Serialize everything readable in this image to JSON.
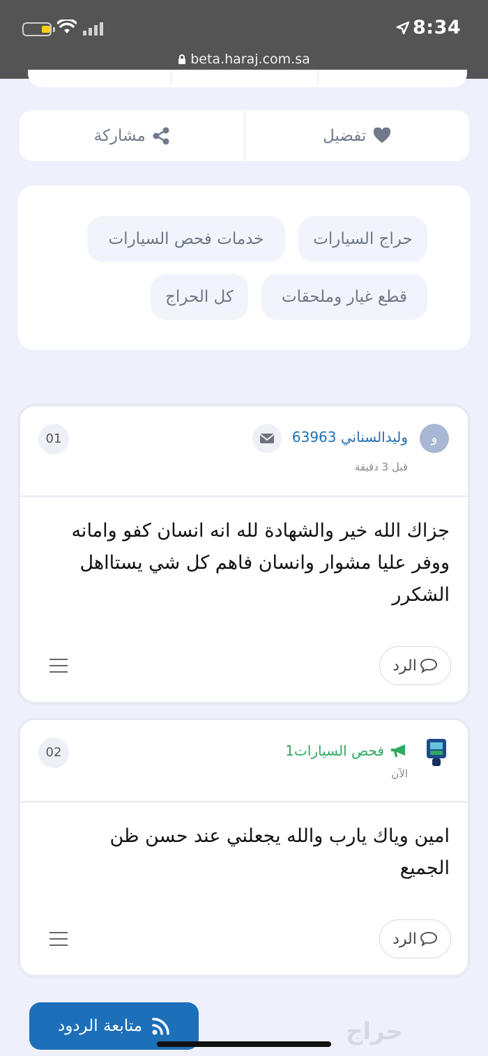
{
  "status_bar": {
    "time": "8:34",
    "url": "beta.haraj.com.sa"
  },
  "actions": {
    "favorite_label": "تفضيل",
    "share_label": "مشاركة"
  },
  "tags": [
    "حراج السيارات",
    "خدمات فحص السيارات",
    "قطع غيار وملحقات",
    "كل الحراج"
  ],
  "comments": [
    {
      "number": "01",
      "avatar_letter": "و",
      "username": "وليدالسناني 63963",
      "time": "قبل 3 دقيقة",
      "text": "جزاك الله خير والشهادة لله انه انسان كفو وامانه ووفر عليا مشوار وانسان فاهم كل شي يستااهل الشكرر",
      "reply_label": "الرد"
    },
    {
      "number": "02",
      "username": "فحص السيارات1",
      "time": "الآن",
      "text": "امين وياك يارب والله يجعلني عند حسن ظن الجميع",
      "reply_label": "الرد"
    }
  ],
  "follow_button_label": "متابعة الردود",
  "watermark": "حراج",
  "colors": {
    "link_blue": "#1f6fb2",
    "seller_green": "#2eaa62",
    "primary_button": "#1d6fb9"
  }
}
